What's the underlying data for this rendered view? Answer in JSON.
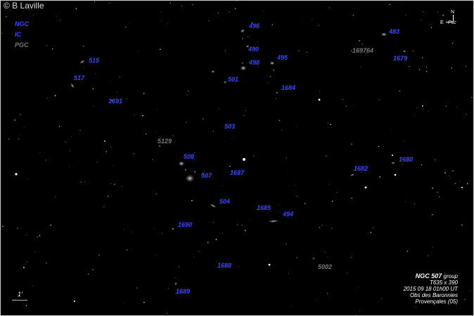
{
  "copyright": "© B Laville",
  "legend": {
    "ngc": "NGC",
    "ic": "IC",
    "pgc": "PGC"
  },
  "compass": {
    "north": "N",
    "east": "E",
    "psc": "Psc"
  },
  "scale": "1'",
  "caption": {
    "title_bold": "NGC 507",
    "title_rest": " group",
    "line2": "T635 x 390",
    "line3": "2015 09 18  01h00 UT",
    "line4": "Obs des Baronnies",
    "line5": "Provençales  (05)"
  },
  "labels": {
    "n496": "496",
    "n483": "483",
    "n169764": "169764",
    "n1679": "1679",
    "n490": "490",
    "n498": "498",
    "n495": "495",
    "n515": "515",
    "n517": "517",
    "n501": "501",
    "n1684": "1684",
    "n1691": "1691",
    "n503": "503",
    "n5129": "5129",
    "n508": "508",
    "n507": "507",
    "n1687": "1687",
    "n1682": "1682",
    "n1680": "1680",
    "n504": "504",
    "n1685": "1685",
    "n494": "494",
    "n1690": "1690",
    "n1688": "1688",
    "n5002": "5002",
    "n1689": "1689"
  }
}
